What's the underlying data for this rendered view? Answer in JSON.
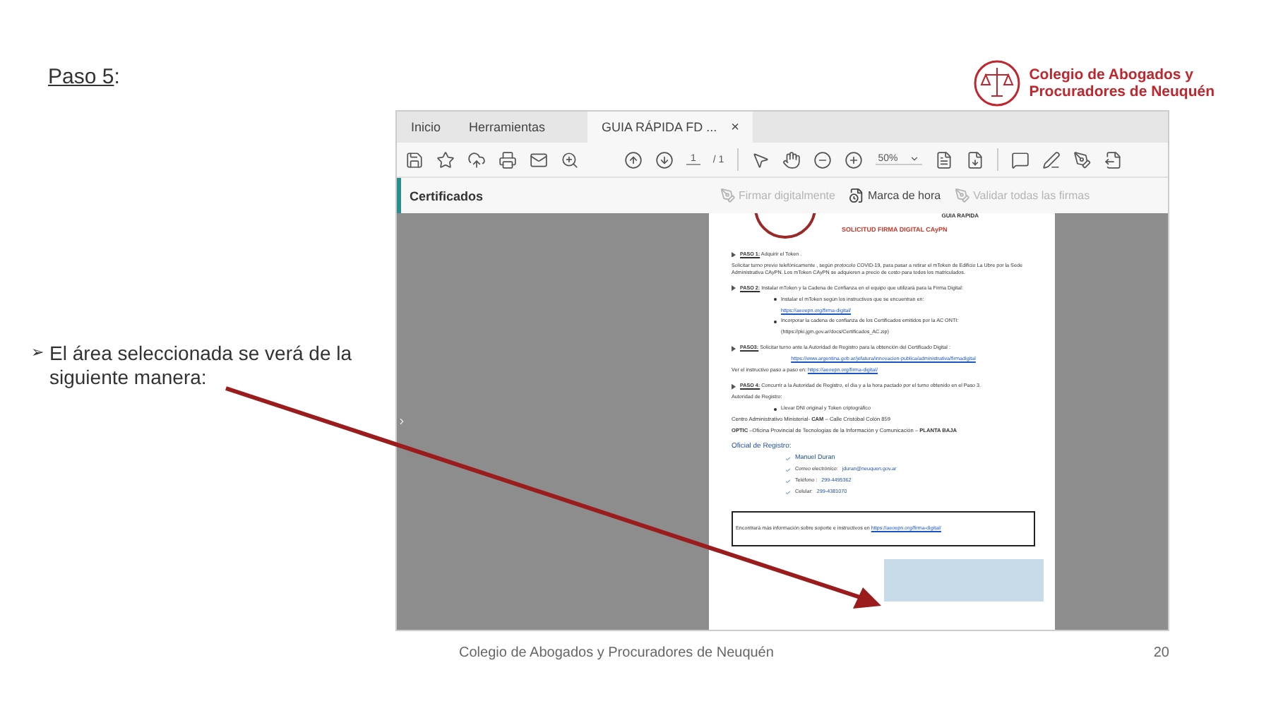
{
  "slide": {
    "heading": "Paso 5",
    "heading_suffix": ":",
    "logo": [
      "Colegio de Abogados y",
      "Procuradores de Neuquén"
    ],
    "bullet": "➢",
    "note": "El  área seleccionada se verá de la siguiente manera:",
    "footer": "Colegio de Abogados y Procuradores de Neuquén",
    "page_number": "20"
  },
  "viewer": {
    "tabs": [
      {
        "label": "Inicio",
        "selected": false,
        "closable": false
      },
      {
        "label": "Herramientas",
        "selected": false,
        "closable": false
      },
      {
        "label": "GUIA  RÁPIDA FD ...",
        "selected": true,
        "closable": true
      }
    ],
    "close_glyph": "×",
    "page": "1",
    "page_total": "/ 1",
    "zoom": "50%",
    "panel_title": "Certificados",
    "panel_actions": [
      {
        "label": "Firmar digitalmente",
        "disabled": true
      },
      {
        "label": "Marca de hora",
        "disabled": false
      },
      {
        "label": "Validar todas las firmas",
        "disabled": true
      }
    ],
    "document": [
      {
        "kind": "header",
        "text": "GUIA  RAPIDA"
      },
      {
        "kind": "title",
        "text": "SOLICITUD FIRMA DIGITAL CAyPN"
      },
      {
        "kind": "step",
        "label": "PASO 1:",
        "text": " Adquirir  el Token ."
      },
      {
        "kind": "para",
        "text": "Solicitar turno previo telefónicamente , según protocolo COVID-19,  para pasar a retirar el mToken  de Edificio La Ubre por la Sede Administrativa CAyPN. Los mToken CAyPN se adquieren a precio de costo para todos los matriculados."
      },
      {
        "kind": "step",
        "label": "PASO 2:",
        "text": " Instalar mToken  y la  Cadena de Confianza en el equipo que utilizará para la Firma Digital:"
      },
      {
        "kind": "sub",
        "text": "Instalar el mToken según los instructivos que se encuentran en:"
      },
      {
        "kind": "sublink",
        "text": "https://aeoepn.org/firma-digital/"
      },
      {
        "kind": "sub",
        "text": "Incorporar la cadena de confianza de los Certificados  emitidos por la AC ONTI:"
      },
      {
        "kind": "subpara",
        "text": "(https://pki.jgm.gov.ar/docs/Certificados_AC.zip)"
      },
      {
        "kind": "step",
        "label": "PASO3:",
        "text": "  Solicitar turno  ante la Autoridad de Registro para la obtención del Certificado Digital :"
      },
      {
        "kind": "link",
        "text": "https://www.argentina.gob.ar/jefatura/innovacion-publica/administrativa/firmadigital"
      },
      {
        "kind": "para_link",
        "text": "Ver el instructivo paso a paso en: ",
        "link": "https://aeoepn.org/firma-digital/"
      },
      {
        "kind": "step",
        "label": "PASO 4:",
        "text": " Concurrir a la Autoridad de Registro, el día y a la hora pactado por el turno obtenido en el Paso 3."
      },
      {
        "kind": "para",
        "text": "Autoridad de Registro:"
      },
      {
        "kind": "sub",
        "text": "Llevar DNI original y Token criptográfico"
      },
      {
        "kind": "address",
        "text": "Centro Administrativo Ministerial- **CAM** –  Calle Cristóbal Colón 859"
      },
      {
        "kind": "address",
        "text": "**OPTIC** –Oficina Provincial de Tecnologías de la Información y Comunicación – **PLANTA BAJA**"
      },
      {
        "kind": "heading2",
        "text": "Oficial de Registro:"
      },
      {
        "kind": "check",
        "label": "Manuel  Duran"
      },
      {
        "kind": "check",
        "label": "Correo electrónico:",
        "value": "jduran@neuquen.gov.ar"
      },
      {
        "kind": "check",
        "label": "Teléfono :",
        "value": "299-4495362"
      },
      {
        "kind": "check",
        "label": "Celular:",
        "value": "299-4381070"
      },
      {
        "kind": "boxed",
        "text": "Encontrará más  información sobre soporte  e instructivos en ",
        "link": "https://aeoepn.org/firma-digital/"
      }
    ]
  }
}
